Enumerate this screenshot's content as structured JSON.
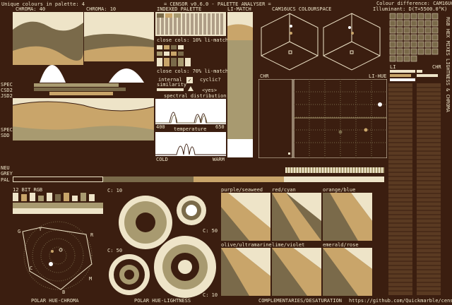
{
  "colors": {
    "dark": "#3b1e10",
    "light": "#eee4c8",
    "mid": "#7a6a4a",
    "tan": "#c9a56a",
    "sand": "#a89a70",
    "white": "#ffffff"
  },
  "header": {
    "unique_colours": "Unique colours in palette: 4",
    "title": "= CENSOR v0.6.0 - PALETTE ANALYSER =",
    "colour_difference": "Colour difference: CAM16UCS",
    "illuminant": "Illuminant: D(T=5500.0°K)"
  },
  "labels": {
    "chroma40": "CHROMA: 40",
    "chroma10": "CHROMA: 10",
    "indexed_palette": "INDEXED PALETTE",
    "li_match": "LI-MATCH",
    "cam16ucs": "CAM16UCS COLOURSPACE",
    "close_cols_1": "close cols: 10% li-match",
    "close_cols_2": "close cols: 70% li-match",
    "internal_similarity": "internal",
    "internal_similarity_2": "similarity",
    "cyclic": "cyclic?",
    "yes": "<yes>",
    "spectral": "spectral distribution",
    "temperature": "temperature",
    "nm_low": "400",
    "nm_high": "650",
    "cold": "COLD",
    "warm": "WARM",
    "chr": "CHR",
    "li_hue": "LI-HUE",
    "li": "LI",
    "chr2": "CHR",
    "spec": "SPEC",
    "csd2": "CSD2",
    "jsd2": "JSD2",
    "spec2": "SPEC",
    "sdd": "SDD",
    "neu": "NEU",
    "grey": "GREY",
    "pal": "PAL",
    "bit12": "12 BIT RGB",
    "c10a": "C: 10",
    "c50a": "C: 50",
    "c50b": "C: 50",
    "c10b": "C: 10",
    "purple_seaweed": "purple/seaweed",
    "red_cyan": "red/cyan",
    "orange_blue": "orange/blue",
    "olive_ultramarine": "olive/ultramarine",
    "lime_violet": "lime/violet",
    "emerald_rose": "emerald/rose",
    "side_vertical": "RGB HEX MIXES LIGHTNESS & CHROMA",
    "polar_hue_chroma": "POLAR HUE-CHROMA",
    "polar_hue_lightness": "POLAR HUE-LIGHTNESS",
    "complementaries": "COMPLEMENTARIES/DESATURATION",
    "url": "https://github.com/Quickmarble/censor",
    "hue_g": "G",
    "hue_y": "Y",
    "hue_r": "R",
    "hue_c": "C",
    "hue_m": "M",
    "hue_b": "B"
  }
}
